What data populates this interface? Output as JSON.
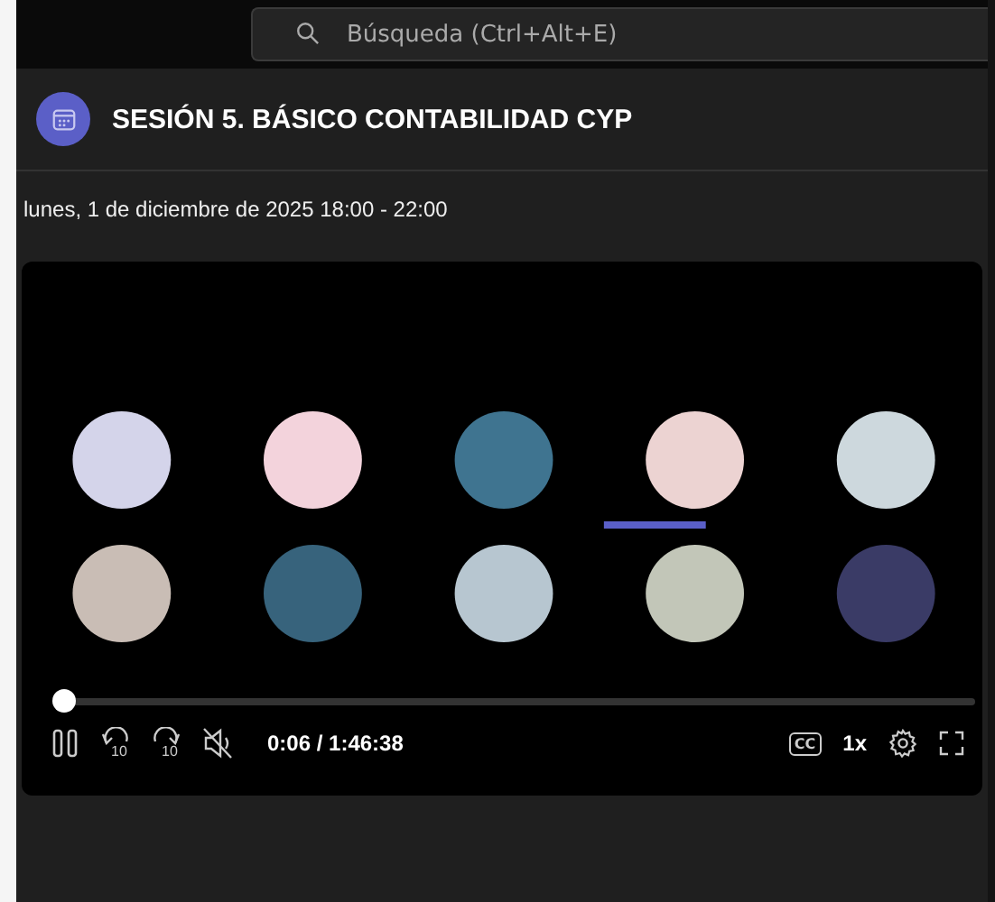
{
  "search": {
    "placeholder": "Búsqueda (Ctrl+Alt+E)"
  },
  "meeting": {
    "title": "SESIÓN 5. BÁSICO CONTABILIDAD CYP",
    "datetime": "lunes, 1 de diciembre de 2025 18:00 - 22:00"
  },
  "video": {
    "kind": "picture",
    "playing": true,
    "muted": true,
    "level": 0.001,
    "time": "0:06 / 1:46:38",
    "rewind_label": "10",
    "forward_label": "10",
    "captions_label": "CC",
    "speed": "1x"
  }
}
